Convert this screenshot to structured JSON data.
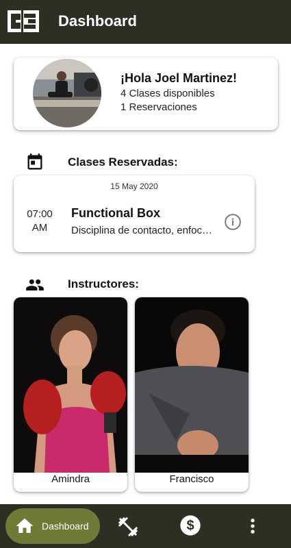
{
  "header": {
    "title": "Dashboard",
    "logo_text": "CE"
  },
  "profile": {
    "greeting": "¡Hola Joel Martinez!",
    "classes_available": "4 Clases disponibles",
    "reservations": "1 Reservaciones"
  },
  "reserved": {
    "section_title": "Clases Reservadas:",
    "date": "15 May 2020",
    "time": "07:00",
    "meridiem": "AM",
    "class_name": "Functional Box",
    "description": "Disciplina de contacto, enfocada en..."
  },
  "instructors": {
    "section_title": "Instructores:",
    "items": [
      {
        "name": "Amindra"
      },
      {
        "name": "Francisco"
      }
    ]
  },
  "bottom_nav": {
    "items": [
      {
        "label": "Dashboard",
        "icon": "home-icon",
        "active": true
      },
      {
        "label": "",
        "icon": "dumbbell-icon",
        "active": false
      },
      {
        "label": "",
        "icon": "dollar-icon",
        "active": false
      },
      {
        "label": "",
        "icon": "more-vert-icon",
        "active": false
      }
    ]
  },
  "colors": {
    "bar": "#2e2f22",
    "accent": "#6e7a35"
  }
}
